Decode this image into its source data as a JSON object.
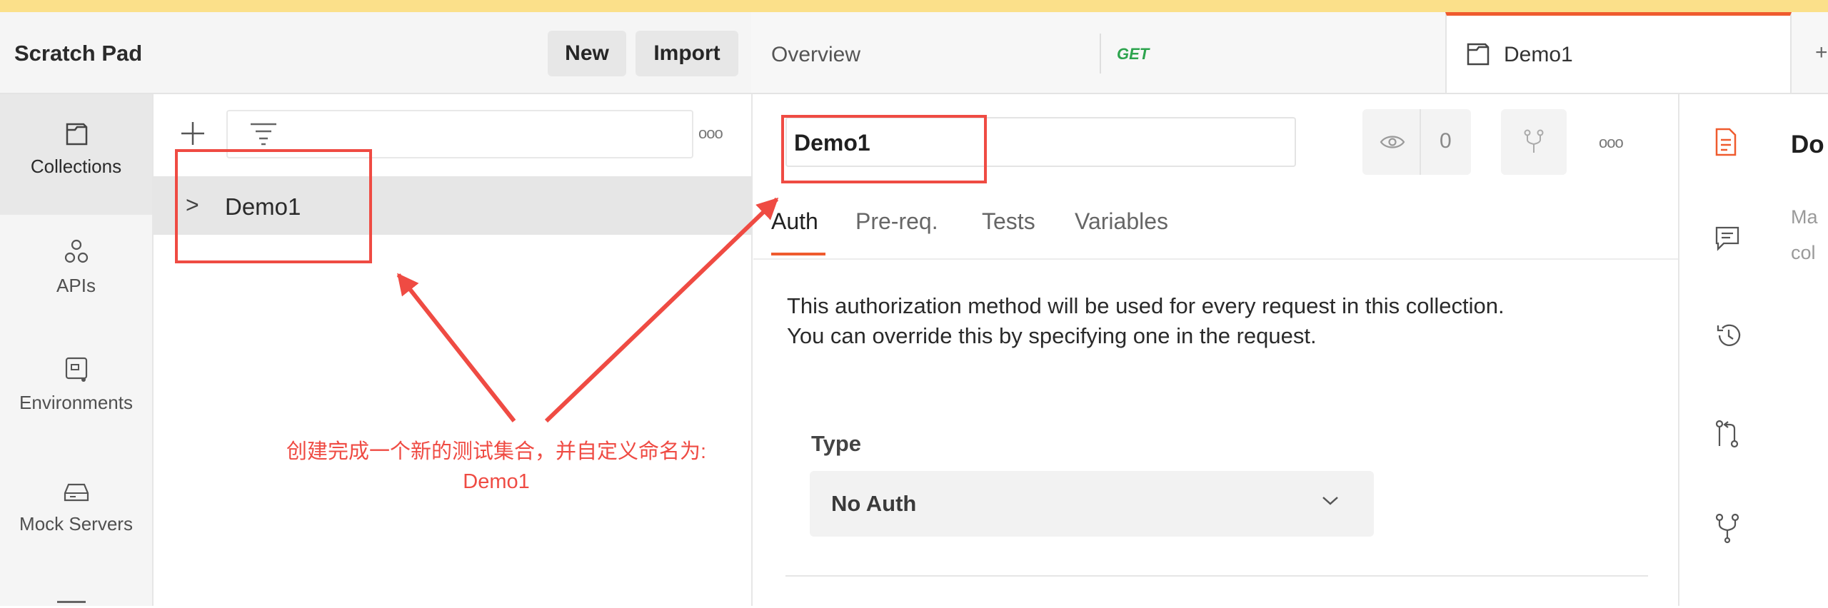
{
  "workspace": {
    "title": "Scratch Pad",
    "new_label": "New",
    "import_label": "Import"
  },
  "sidebar": {
    "items": [
      {
        "label": "Collections",
        "icon": "collection-icon",
        "active": true
      },
      {
        "label": "APIs",
        "icon": "apis-icon"
      },
      {
        "label": "Environments",
        "icon": "environment-icon"
      },
      {
        "label": "Mock Servers",
        "icon": "mock-server-icon"
      }
    ]
  },
  "collections": {
    "items": [
      {
        "name": "Demo1",
        "chevron": ">"
      }
    ]
  },
  "tabs": {
    "overview": "Overview",
    "get_method": "GET",
    "active_label": "Demo1",
    "more": "+"
  },
  "editor": {
    "name_value": "Demo1",
    "watch_count": "0",
    "subtabs": [
      "Auth",
      "Pre-req.",
      "Tests",
      "Variables"
    ],
    "auth_desc_line1": "This authorization method will be used for every request in this collection.",
    "auth_desc_line2": "You can override this by specifying one in the request.",
    "type_label": "Type",
    "type_value": "No Auth"
  },
  "right_panel": {
    "title": "Do",
    "sub_line1": "Ma",
    "sub_line2": "col"
  },
  "annotation": {
    "text_line1": "创建完成一个新的测试集合，并自定义命名为:",
    "text_line2": "Demo1"
  },
  "colors": {
    "accent": "#ef5b2e",
    "annotation": "#ef4b43",
    "get": "#2da44e",
    "topstrip": "#fbe08a"
  }
}
